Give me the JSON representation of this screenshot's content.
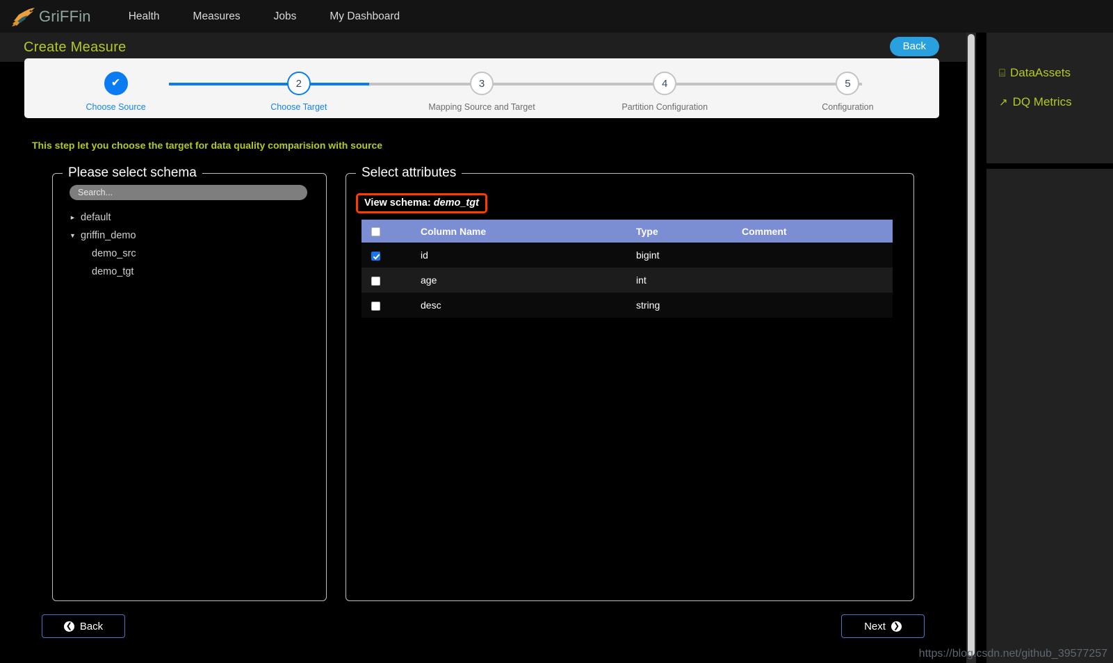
{
  "nav": {
    "brand": "GriFFin",
    "links": [
      {
        "label": "Health"
      },
      {
        "label": "Measures"
      },
      {
        "label": "Jobs"
      },
      {
        "label": "My Dashboard"
      }
    ]
  },
  "header": {
    "title": "Create Measure",
    "back_label": "Back"
  },
  "stepper": {
    "steps": [
      {
        "num": "✔",
        "label": "Choose Source"
      },
      {
        "num": "2",
        "label": "Choose Target"
      },
      {
        "num": "3",
        "label": "Mapping Source and Target"
      },
      {
        "num": "4",
        "label": "Partition Configuration"
      },
      {
        "num": "5",
        "label": "Configuration"
      }
    ]
  },
  "main": {
    "hint": "This step let you choose the target for data quality comparision with source",
    "schema_panel": {
      "legend": "Please select schema",
      "search_placeholder": "Search...",
      "tree": [
        {
          "caret": "►",
          "label": "default",
          "expanded": false
        },
        {
          "caret": "▼",
          "label": "griffin_demo",
          "expanded": true
        }
      ],
      "children": [
        {
          "label": "demo_src"
        },
        {
          "label": "demo_tgt"
        }
      ]
    },
    "attributes_panel": {
      "legend": "Select attributes",
      "badge_prefix": "View schema:",
      "badge_schema": "demo_tgt",
      "columns": [
        "Column Name",
        "Type",
        "Comment"
      ],
      "rows": [
        {
          "checked": true,
          "name": "id",
          "type": "bigint",
          "comment": ""
        },
        {
          "checked": false,
          "name": "age",
          "type": "int",
          "comment": ""
        },
        {
          "checked": false,
          "name": "desc",
          "type": "string",
          "comment": ""
        }
      ]
    },
    "footer": {
      "back_label": "Back",
      "next_label": "Next"
    }
  },
  "right_rail": {
    "items": [
      {
        "icon": "⌸",
        "label": "DataAssets"
      },
      {
        "icon": "↗",
        "label": "DQ Metrics"
      }
    ]
  },
  "watermark": "https://blog.csdn.net/github_39577257"
}
